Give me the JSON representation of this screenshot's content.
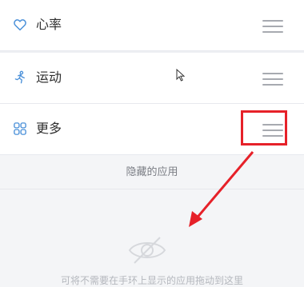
{
  "rows": [
    {
      "label": "心率",
      "icon": "heart-icon"
    },
    {
      "label": "运动",
      "icon": "running-person-icon"
    },
    {
      "label": "更多",
      "icon": "grid-icon"
    }
  ],
  "hidden_section": {
    "title": "隐藏的应用",
    "empty_text": "可将不需要在手环上显示的应用拖动到这里",
    "icon": "eye-off-icon"
  },
  "colors": {
    "accent_blue": "#4a90d9",
    "annotation_red": "#e62129",
    "handle_gray": "#a7aab0"
  }
}
